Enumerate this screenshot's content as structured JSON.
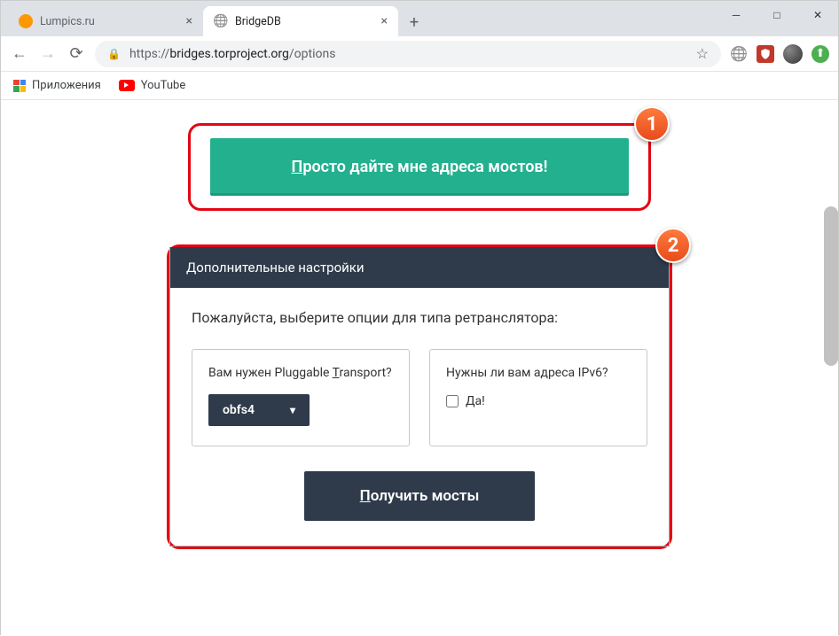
{
  "window": {
    "tabs": [
      {
        "title": "Lumpics.ru",
        "favicon": "orange",
        "active": false
      },
      {
        "title": "BridgeDB",
        "favicon": "globe",
        "active": true
      }
    ]
  },
  "address": {
    "scheme": "https://",
    "host": "bridges.torproject.org",
    "path": "/options"
  },
  "bookmarks": {
    "apps": "Приложения",
    "youtube": "YouTube"
  },
  "callouts": {
    "one": "1",
    "two": "2"
  },
  "main_button": {
    "prefix_u": "П",
    "rest": "росто дайте мне адреса мостов!"
  },
  "panel": {
    "header": "Дополнительные настройки",
    "prompt": "Пожалуйста, выберите опции для типа ретранслятора:",
    "card_transport": {
      "q_pre": "Вам нужен Pluggable ",
      "q_u": "T",
      "q_post": "ransport?",
      "value": "obfs4"
    },
    "card_ipv6": {
      "q": "Нужны ли вам адреса IPv6?",
      "yes": "Да!"
    },
    "submit": {
      "prefix_u": "П",
      "rest": "олучить мосты"
    }
  }
}
